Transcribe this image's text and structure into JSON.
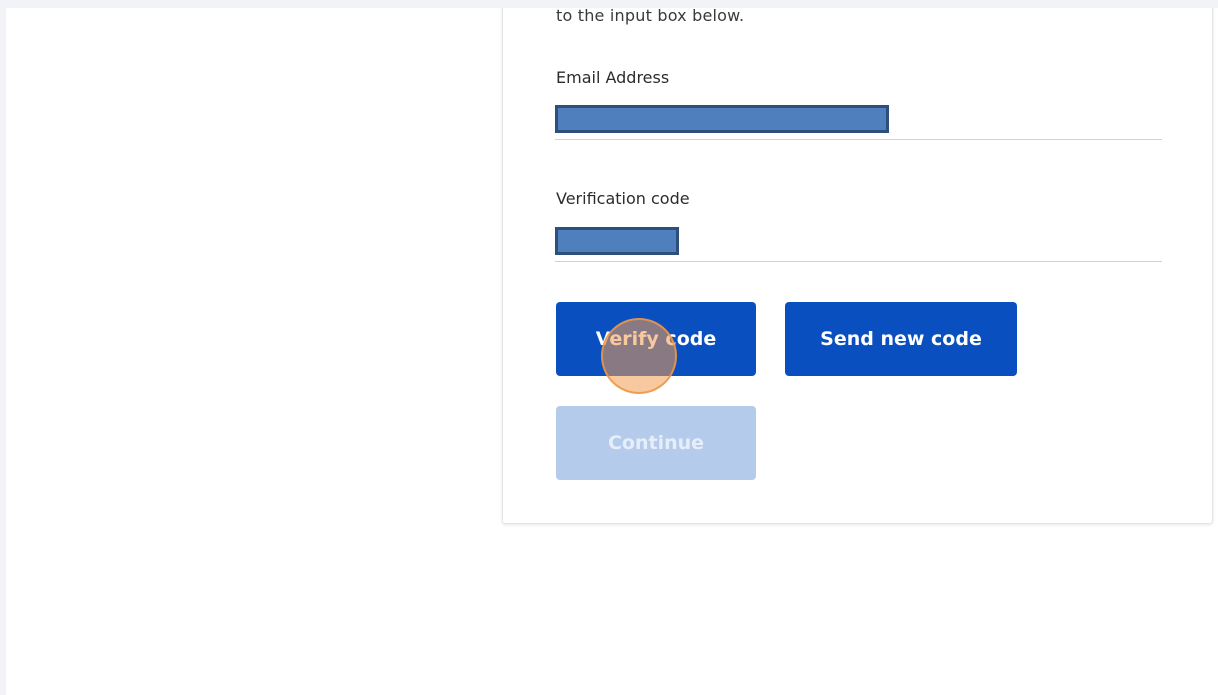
{
  "form": {
    "intro_text": "to the input box below.",
    "email": {
      "label": "Email Address",
      "value": ""
    },
    "verification": {
      "label": "Verification code",
      "value": ""
    },
    "buttons": {
      "verify": "Verify code",
      "send_new": "Send new code",
      "continue": "Continue"
    },
    "continue_enabled": false
  },
  "colors": {
    "page_background": "#f1f3f6",
    "primary_button": "#0a4fbf",
    "disabled_button": "#b4cbeb",
    "redaction_fill": "#4f80bd",
    "redaction_border": "#2e4f7c",
    "click_marker": "#f39c50"
  }
}
